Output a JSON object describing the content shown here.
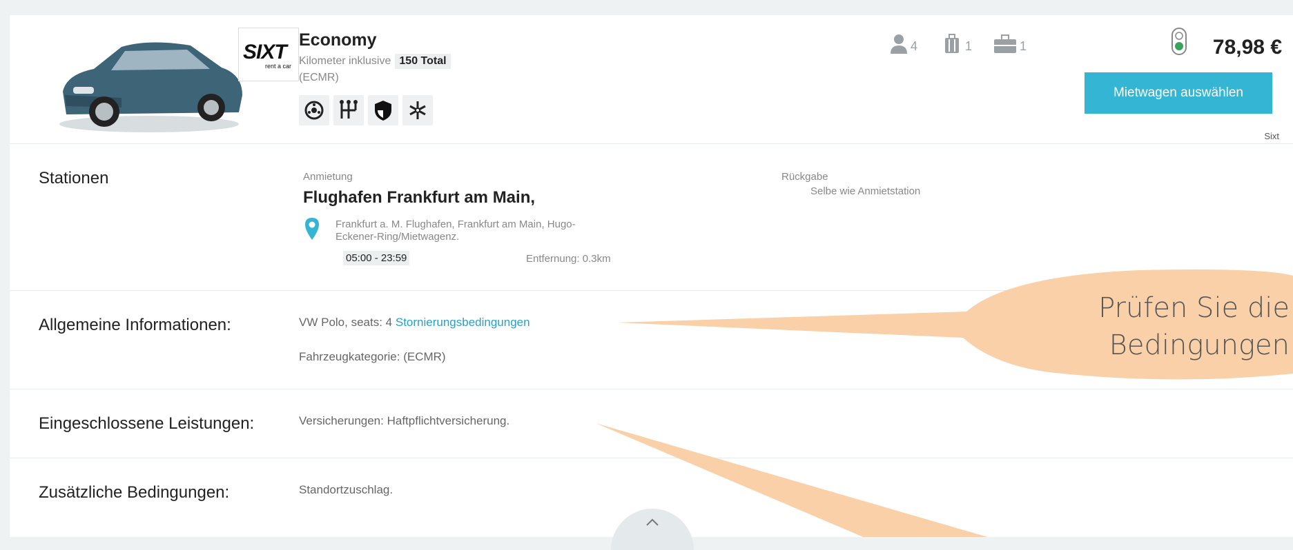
{
  "offer": {
    "category": "Economy",
    "km_label": "Kilometer inklusive",
    "km_value": "150 Total",
    "code": "(ECMR)",
    "feature_icons": [
      "ac-icon",
      "gearshift-icon",
      "shield-icon",
      "snowflake-icon"
    ],
    "passengers": "4",
    "bags_large": "1",
    "bags_small": "1",
    "price": "78,98 €",
    "select_label": "Mietwagen auswählen",
    "vendor": "Sixt",
    "logo_text": "SIXT",
    "logo_sub": "rent a car"
  },
  "stations": {
    "label": "Stationen",
    "pickup_label": "Anmietung",
    "pickup_name": "Flughafen Frankfurt am Main,",
    "pickup_address_1": "Frankfurt a. M. Flughafen, Frankfurt am Main, Hugo-",
    "pickup_address_2": "Eckener-Ring/Mietwagenz.",
    "hours": "05:00 - 23:59",
    "distance": "Entfernung: 0.3km",
    "return_label": "Rückgabe",
    "return_value": "Selbe wie Anmietstation"
  },
  "general": {
    "label": "Allgemeine Informationen:",
    "model": "VW Polo, seats: 4",
    "cancel_link": "Stornierungsbedingungen",
    "category_line": "Fahrzeugkategorie: (ECMR)"
  },
  "included": {
    "label": "Eingeschlossene Leistungen:",
    "value": "Versicherungen: Haftpflichtversicherung."
  },
  "additional": {
    "label": "Zusätzliche Bedingungen:",
    "value": "Standortzuschlag."
  },
  "callout": {
    "line1": "Prüfen Sie die",
    "line2": "Bedingungen"
  },
  "colors": {
    "accent": "#35b5d4",
    "callout": "#f9d0a8"
  }
}
